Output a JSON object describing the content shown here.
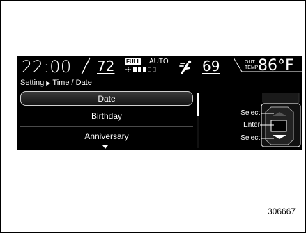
{
  "status_bar": {
    "clock": "22:00",
    "driver_temp": "72",
    "fan_badge": "FULL",
    "fan_mode": "AUTO",
    "fan_level": 3,
    "fan_level_max": 5,
    "passenger_temp": "69",
    "outside_label_top": "OUT",
    "outside_label_bottom": "TEMP",
    "outside_temp": "86°F"
  },
  "breadcrumb": {
    "root": "Setting",
    "current": "Time / Date"
  },
  "menu": {
    "items": [
      {
        "label": "Date",
        "selected": true
      },
      {
        "label": "Birthday",
        "selected": false
      },
      {
        "label": "Anniversary",
        "selected": false
      }
    ]
  },
  "controller": {
    "select_up_label": "Select",
    "enter_label": "Enter",
    "select_down_label": "Select"
  },
  "figure_number": "306667",
  "colors": {
    "screen_bg": "#000000",
    "text": "#ffffff",
    "selected_border": "#cfcfcf"
  },
  "icons": [
    "fan-icon",
    "airflow-icon",
    "breadcrumb-arrow-icon",
    "scroll-down-icon",
    "controller-up-icon",
    "controller-down-icon"
  ]
}
